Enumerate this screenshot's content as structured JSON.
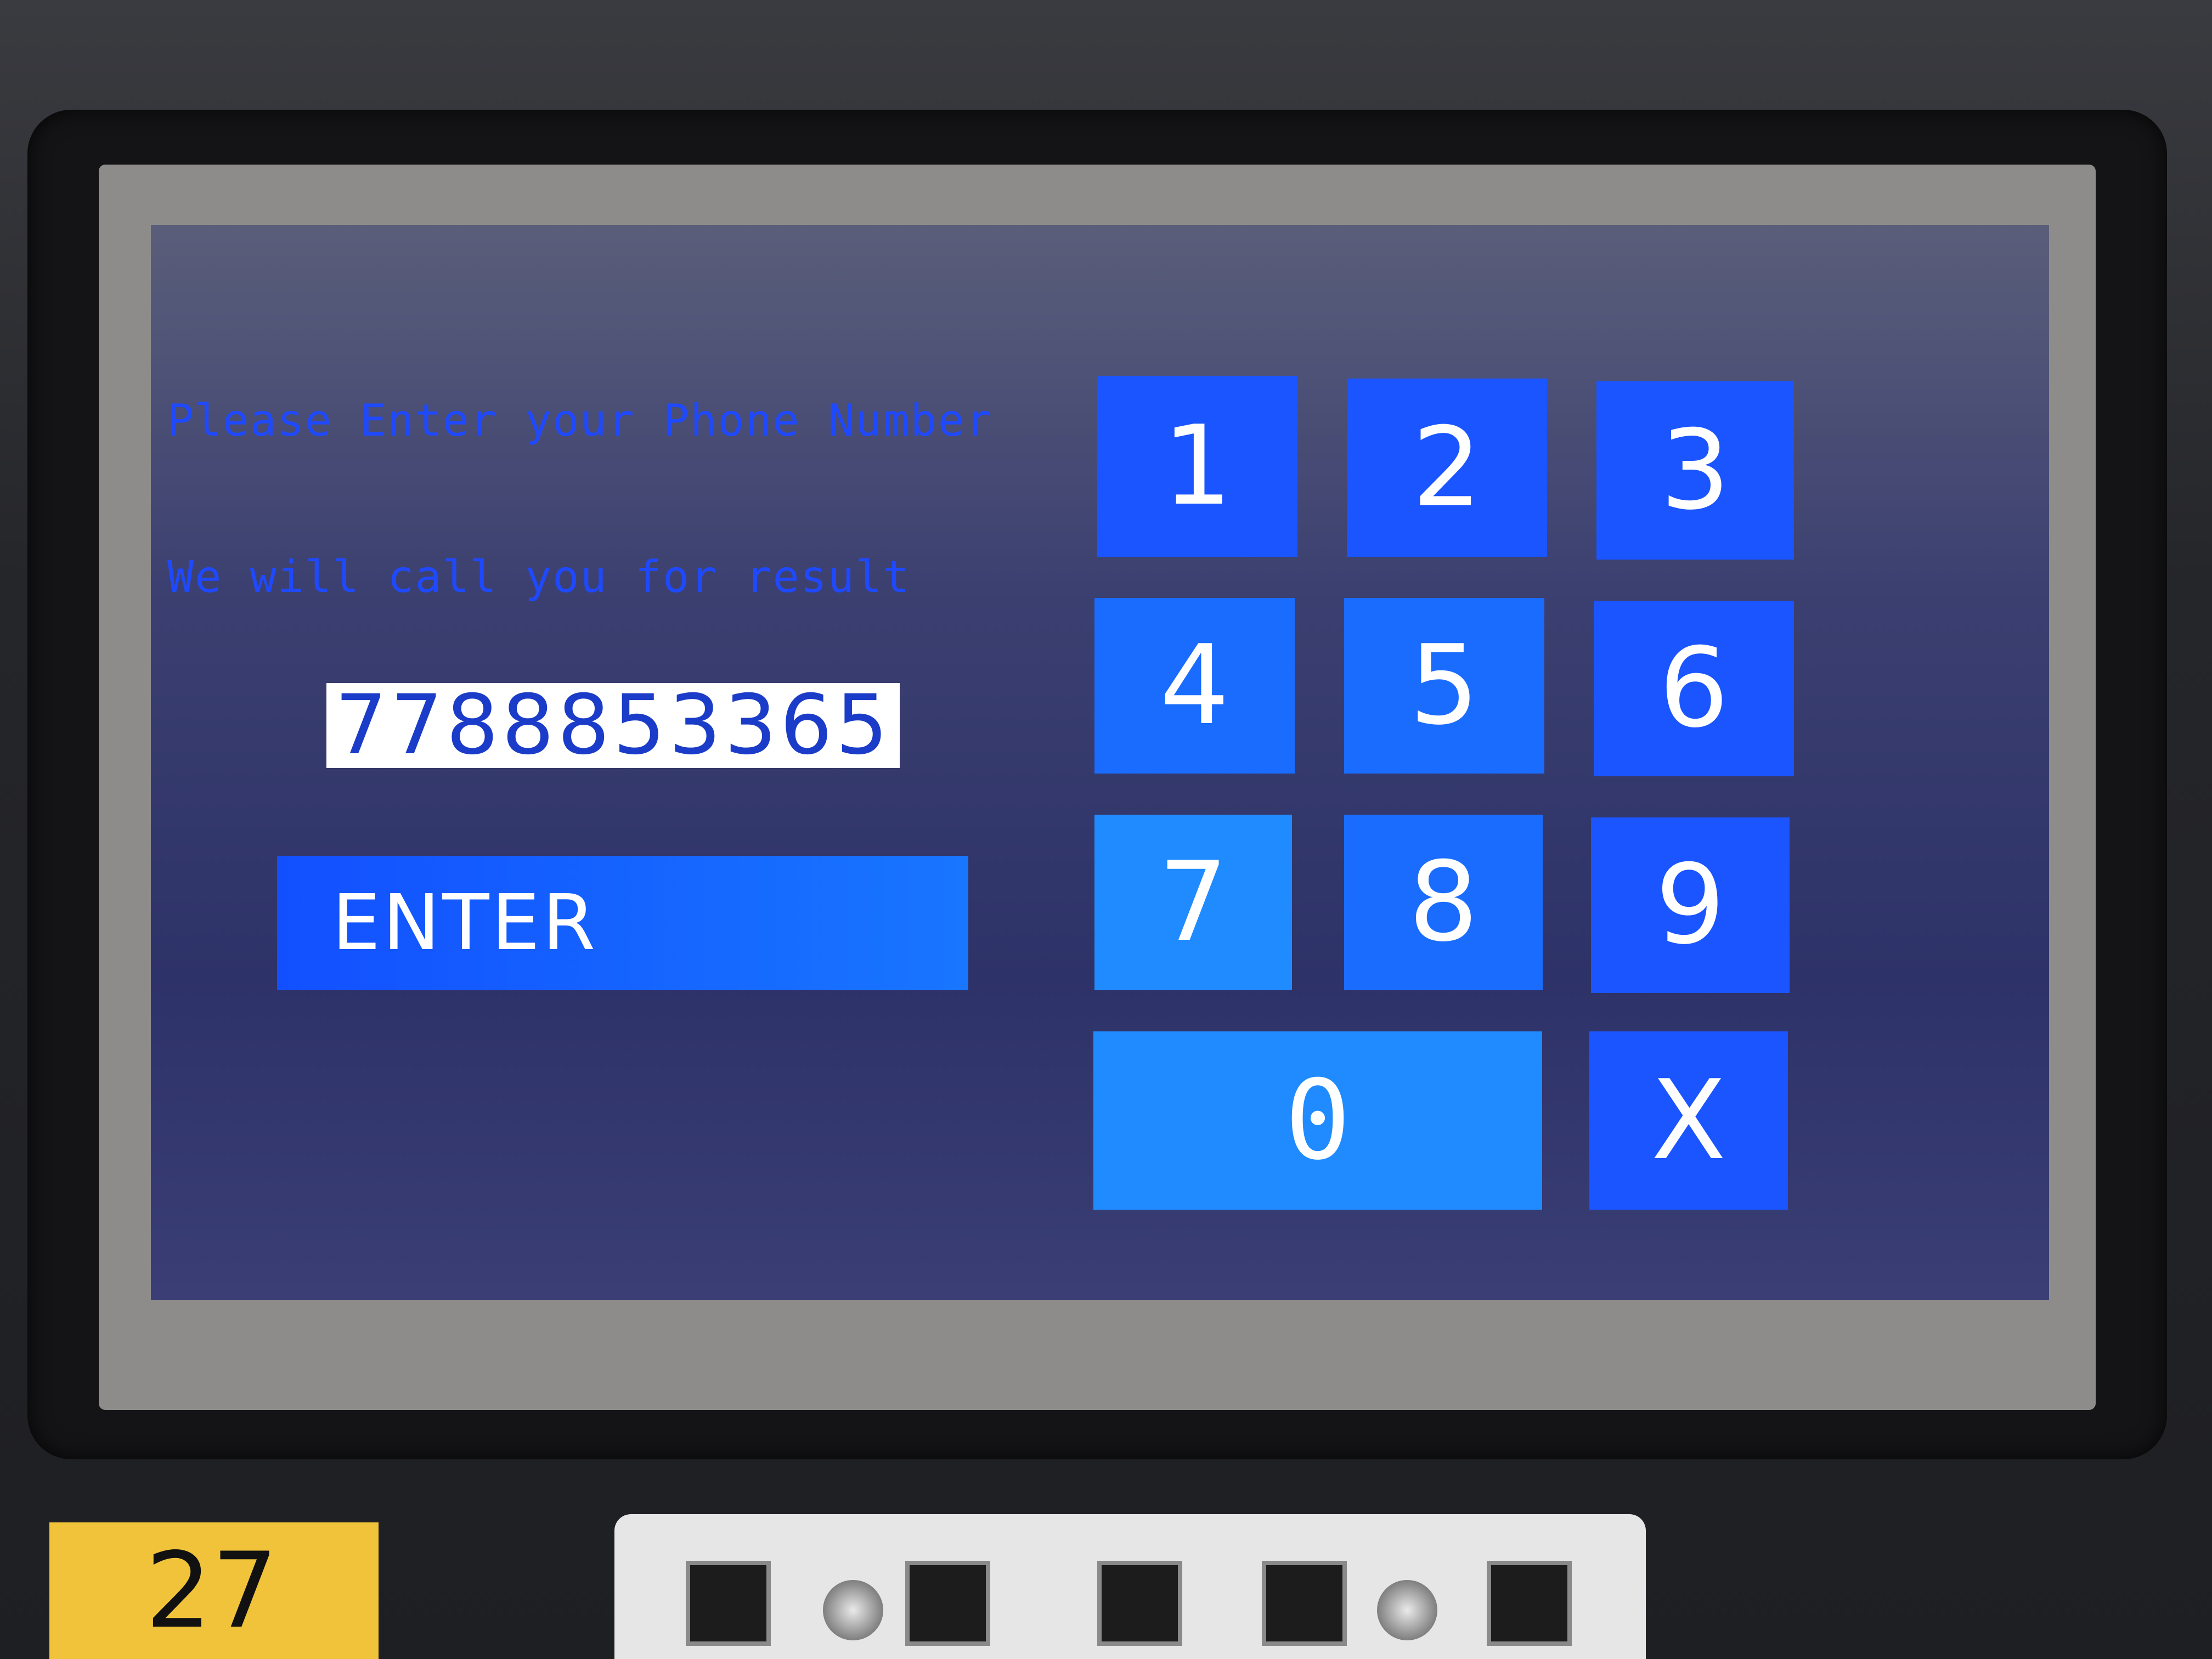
{
  "prompt": {
    "line1": "Please Enter your Phone Number",
    "line2": "We will call you for result"
  },
  "phone_display": {
    "value": "7788853365"
  },
  "enter_button": {
    "label": "ENTER"
  },
  "keypad": {
    "keys": [
      "1",
      "2",
      "3",
      "4",
      "5",
      "6",
      "7",
      "8",
      "9",
      "0",
      "X"
    ]
  },
  "device": {
    "tag_number": "27"
  },
  "colors": {
    "screen_bg": "#3b3f70",
    "prompt_text": "#1e49ff",
    "key_blue": "#1a55ff",
    "key_light_blue": "#1f8bff",
    "display_bg": "#ffffff"
  }
}
